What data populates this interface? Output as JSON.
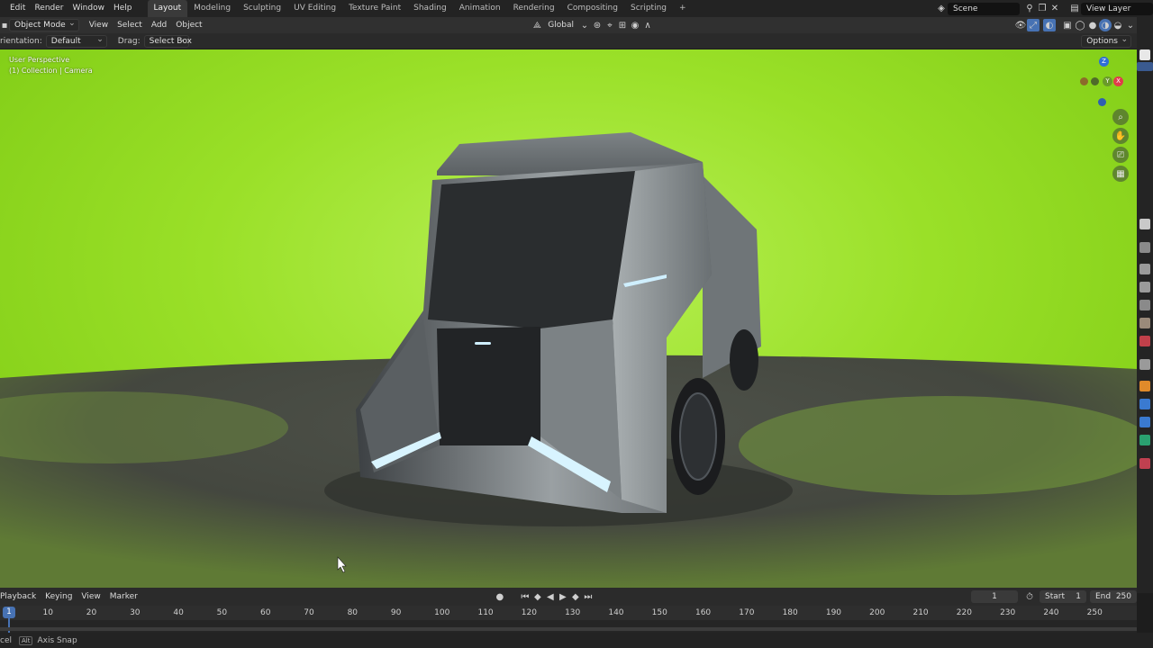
{
  "topbar": {
    "menus": [
      "Edit",
      "Render",
      "Window",
      "Help"
    ],
    "workspaces": [
      "Layout",
      "Modeling",
      "Sculpting",
      "UV Editing",
      "Texture Paint",
      "Shading",
      "Animation",
      "Rendering",
      "Compositing",
      "Scripting"
    ],
    "active_workspace": "Layout",
    "add_tab": "+",
    "scene": "Scene",
    "view_layer": "View Layer"
  },
  "header": {
    "mode": "Object Mode",
    "menus": [
      "View",
      "Select",
      "Add",
      "Object"
    ],
    "transform_orientation": "Global"
  },
  "toolbar": {
    "orientation_label": "rientation:",
    "orientation_value": "Default",
    "drag_label": "Drag:",
    "drag_value": "Select Box",
    "options": "Options"
  },
  "viewport": {
    "view_name": "User Perspective",
    "collection_info": "(1) Collection | Camera",
    "gizmo": {
      "z": "Z",
      "y": "Y",
      "x": "X"
    },
    "colors": {
      "sky_center": "#b8f055",
      "sky_edge": "#7bc812",
      "floor": "#4a4d45",
      "body": "#8e9497",
      "glass": "#2a2d2f",
      "light": "#d8f4ff"
    }
  },
  "timeline": {
    "menus": [
      "Playback",
      "Keying",
      "View",
      "Marker"
    ],
    "current_frame": "1",
    "start_label": "Start",
    "start_value": "1",
    "end_label": "End",
    "end_value": "250",
    "ticks": [
      "10",
      "20",
      "30",
      "40",
      "50",
      "60",
      "70",
      "80",
      "90",
      "100",
      "110",
      "120",
      "130",
      "140",
      "150",
      "160",
      "170",
      "180",
      "190",
      "200",
      "210",
      "220",
      "230",
      "240",
      "250"
    ],
    "playhead": "1"
  },
  "statusbar": {
    "left": "cel",
    "key": "Alt",
    "hint": "Axis Snap"
  }
}
